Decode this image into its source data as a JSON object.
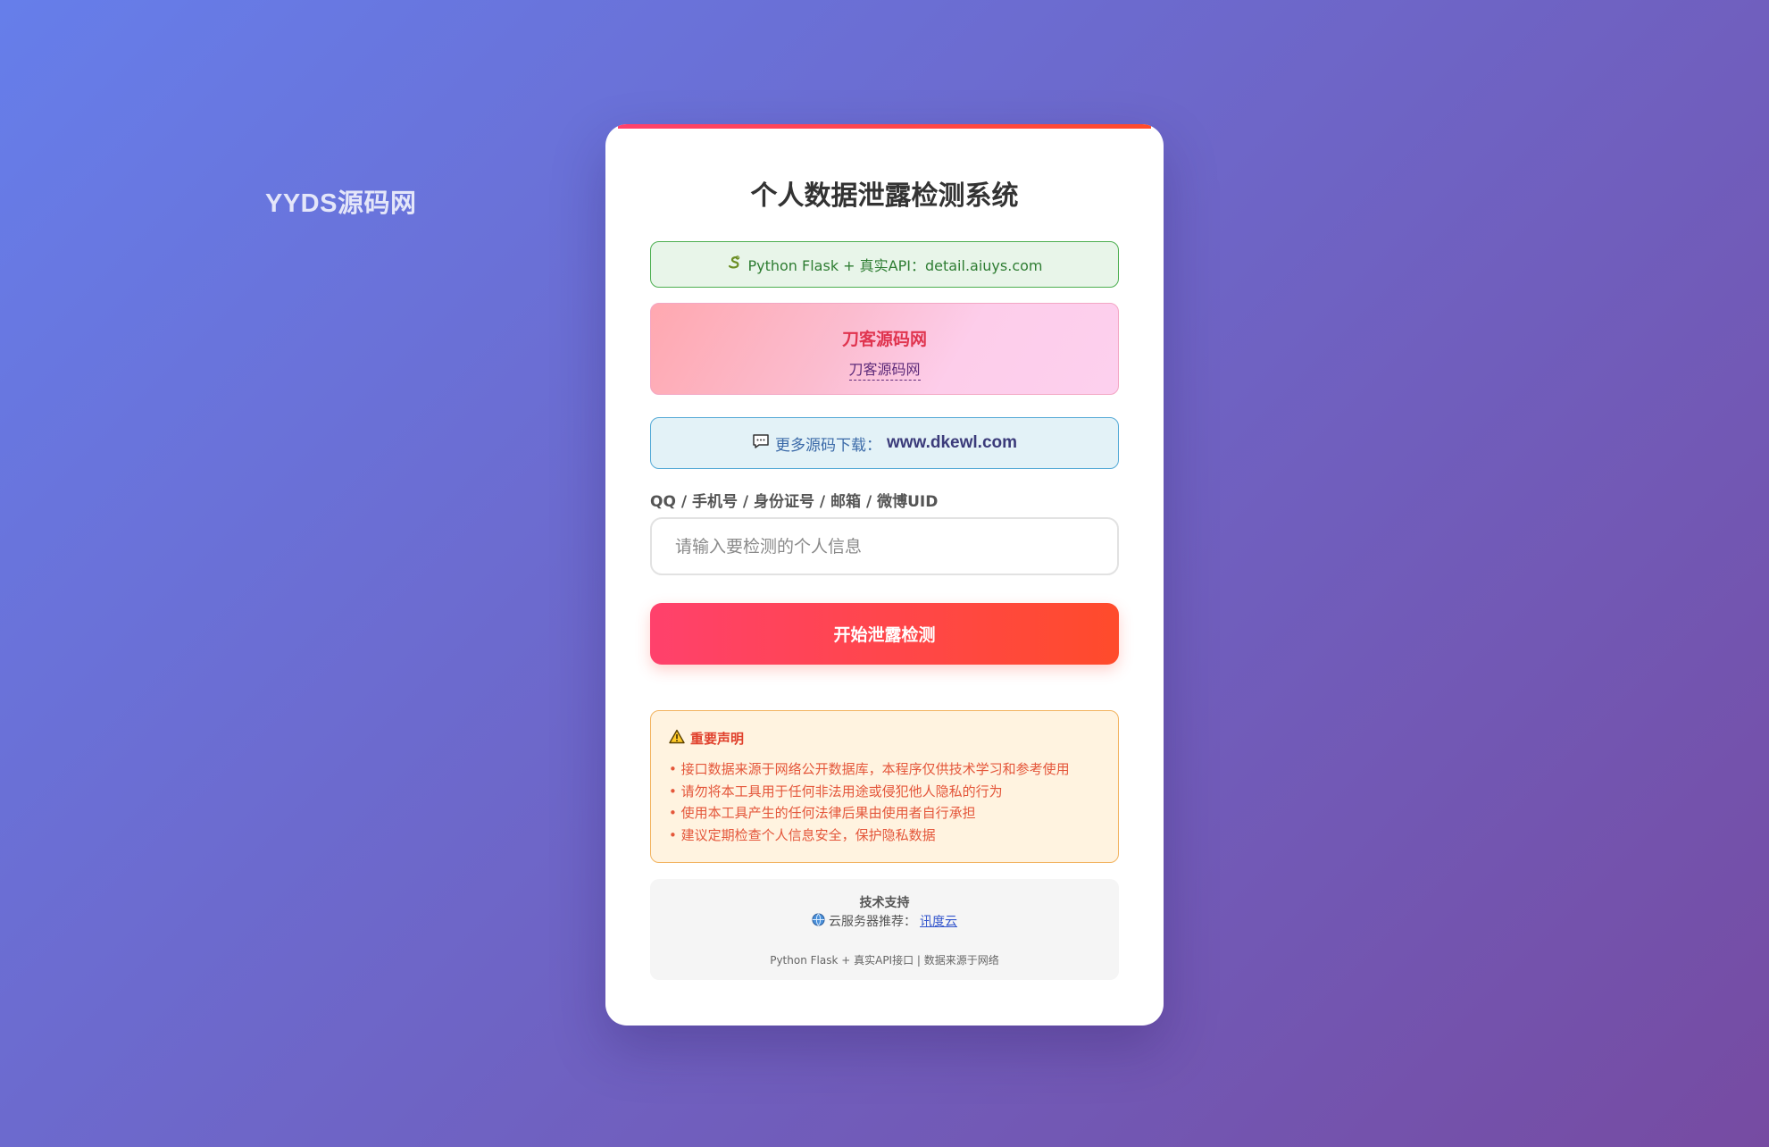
{
  "watermark": "YYDS源码网",
  "title": "个人数据泄露检测系统",
  "api": {
    "icon": "snake-icon",
    "text": "Python Flask + 真实API：detail.aiuys.com"
  },
  "brand": {
    "title": "刀客源码网",
    "link": "刀客源码网"
  },
  "more": {
    "icon": "chat-icon",
    "prefix": "更多源码下载：",
    "site": "www.dkewl.com"
  },
  "input": {
    "label": "QQ / 手机号 / 身份证号 / 邮箱 / 微博UID",
    "placeholder": "请输入要检测的个人信息",
    "value": ""
  },
  "button": {
    "label": "开始泄露检测"
  },
  "notice": {
    "icon": "warning-icon",
    "title": "重要声明",
    "items": [
      "接口数据来源于网络公开数据库，本程序仅供技术学习和参考使用",
      "请勿将本工具用于任何非法用途或侵犯他人隐私的行为",
      "使用本工具产生的任何法律后果由使用者自行承担",
      "建议定期检查个人信息安全，保护隐私数据"
    ]
  },
  "support": {
    "title": "技术支持",
    "cloud_icon": "globe-icon",
    "cloud_prefix": "云服务器推荐：",
    "cloud_link": "讯度云",
    "footer": "Python Flask + 真实API接口 | 数据来源于网络"
  },
  "colors": {
    "accent_start": "#ff416c",
    "accent_end": "#ff4b2b",
    "bg_start": "#667eea",
    "bg_end": "#764ba2"
  }
}
